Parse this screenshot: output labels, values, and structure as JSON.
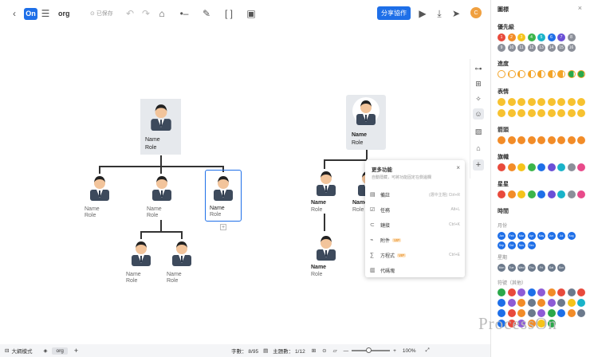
{
  "toolbar": {
    "back_icon": "chevron-left-icon",
    "logo_text": "On",
    "menu_icon": "hamburger-icon",
    "title": "org",
    "saved_text": "已保存",
    "share_label": "分享協作",
    "avatar_text": "C"
  },
  "nodes": {
    "root_left": {
      "name": "Name",
      "role": "Role"
    },
    "n1": {
      "name": "Name",
      "role": "Role"
    },
    "n2": {
      "name": "Name",
      "role": "Role"
    },
    "n3": {
      "name": "Name",
      "role": "Role"
    },
    "n4": {
      "name": "Name",
      "role": "Role"
    },
    "n5": {
      "name": "Name",
      "role": "Role"
    },
    "root_right": {
      "name": "Name",
      "role": "Role"
    },
    "r1": {
      "name": "Name",
      "role": "Role"
    },
    "r2": {
      "name": "Name",
      "role": "Role"
    },
    "r3": {
      "name": "Name",
      "role": "Role"
    }
  },
  "context_menu": {
    "title": "更多功能",
    "subtitle": "自動隱藏，可將功能固定在側邊欄",
    "items": [
      {
        "icon": "note-icon",
        "label": "備註",
        "hint": "(選中主題)  Ctrl+R"
      },
      {
        "icon": "task-icon",
        "label": "任務",
        "hint": "Alt+L"
      },
      {
        "icon": "link-icon",
        "label": "鏈接",
        "hint": "Ctrl+K"
      },
      {
        "icon": "attachment-icon",
        "label": "附件",
        "vip": "VIP",
        "hint": ""
      },
      {
        "icon": "formula-icon",
        "label": "方程式",
        "vip": "VIP",
        "hint": "Ctrl+E"
      },
      {
        "icon": "code-icon",
        "label": "代碼塊",
        "hint": ""
      }
    ]
  },
  "panel": {
    "title": "圖標",
    "sections": {
      "priority": "優先級",
      "progress": "進度",
      "emotion": "表情",
      "arrow": "箭頭",
      "flag": "旗幟",
      "star": "星星",
      "time": "時間",
      "month": "月份",
      "week": "星期",
      "symbol": "符號（其他）"
    },
    "priority_numbers": [
      "1",
      "2",
      "3",
      "4",
      "5",
      "6",
      "7",
      "8",
      "9",
      "10",
      "11",
      "12",
      "13",
      "14",
      "15",
      "16"
    ],
    "months": [
      "Jan",
      "Feb",
      "Mar",
      "Apr",
      "May",
      "Jun",
      "Jul",
      "Aug",
      "Sep",
      "Oct",
      "Nov",
      "Dec"
    ],
    "weekdays": [
      "Mon",
      "Tue",
      "Wed",
      "Thu",
      "Fri",
      "Sat",
      "Sun"
    ]
  },
  "bottom": {
    "outline_label": "大綱模式",
    "sheet_tab": "org",
    "word_count": "字數： 8/95",
    "topic_count": "主題數： 1/12",
    "zoom": "100%"
  },
  "watermark": "ProcessOn",
  "colors": {
    "accent": "#1e6fe8",
    "priority": [
      "#e84a3c",
      "#f28c28",
      "#f5c31a",
      "#3bb54a",
      "#19b3c9",
      "#1e6fe8",
      "#6a4fd6",
      "#8b8f99"
    ]
  }
}
